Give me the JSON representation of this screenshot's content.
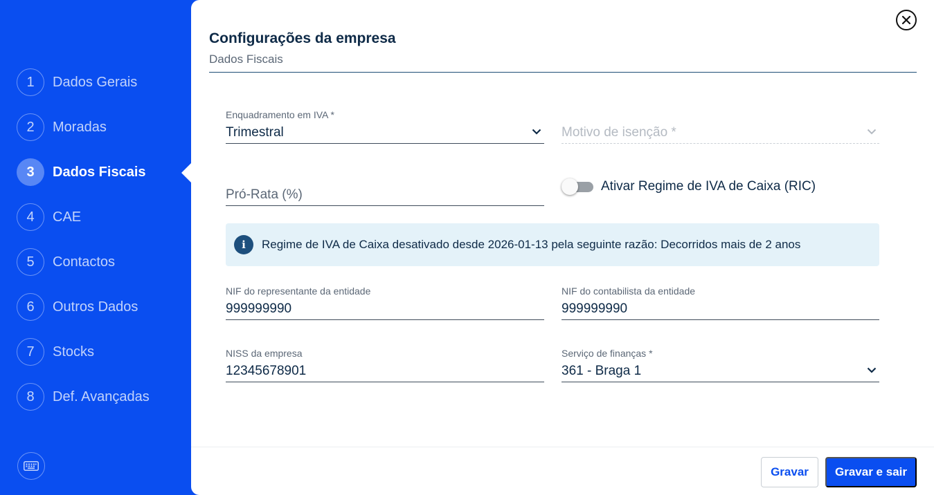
{
  "sidebar": {
    "steps": [
      {
        "num": "1",
        "label": "Dados Gerais"
      },
      {
        "num": "2",
        "label": "Moradas"
      },
      {
        "num": "3",
        "label": "Dados Fiscais"
      },
      {
        "num": "4",
        "label": "CAE"
      },
      {
        "num": "5",
        "label": "Contactos"
      },
      {
        "num": "6",
        "label": "Outros Dados"
      },
      {
        "num": "7",
        "label": "Stocks"
      },
      {
        "num": "8",
        "label": "Def. Avançadas"
      }
    ],
    "active_step": "3",
    "keyboard_icon": "keyboard-icon"
  },
  "header": {
    "title": "Configurações da empresa",
    "subtitle": "Dados Fiscais"
  },
  "form": {
    "vat_regime": {
      "label": "Enquadramento em IVA *",
      "value": "Trimestral"
    },
    "exemption_reason": {
      "placeholder": "Motivo de isenção *",
      "value": ""
    },
    "pro_rata": {
      "placeholder": "Pró-Rata (%)",
      "value": ""
    },
    "cash_vat_toggle": {
      "label": "Ativar Regime de IVA de Caixa (RIC)",
      "on": false
    },
    "info_message": "Regime de IVA de Caixa desativado desde 2026-01-13 pela seguinte razão: Decorridos mais de 2 anos",
    "rep_nif": {
      "label": "NIF do representante da entidade",
      "value": "999999990"
    },
    "acc_nif": {
      "label": "NIF do contabilista da entidade",
      "value": "999999990"
    },
    "niss": {
      "label": "NISS da empresa",
      "value": "12345678901"
    },
    "tax_office": {
      "label": "Serviço de finanças *",
      "value": "361 - Braga 1"
    }
  },
  "footer": {
    "save_label": "Gravar",
    "save_exit_label": "Gravar e sair"
  },
  "colors": {
    "brand_blue": "#0a4ef0",
    "info_bg": "#e4f2f9",
    "text_dark": "#0e2a47"
  }
}
